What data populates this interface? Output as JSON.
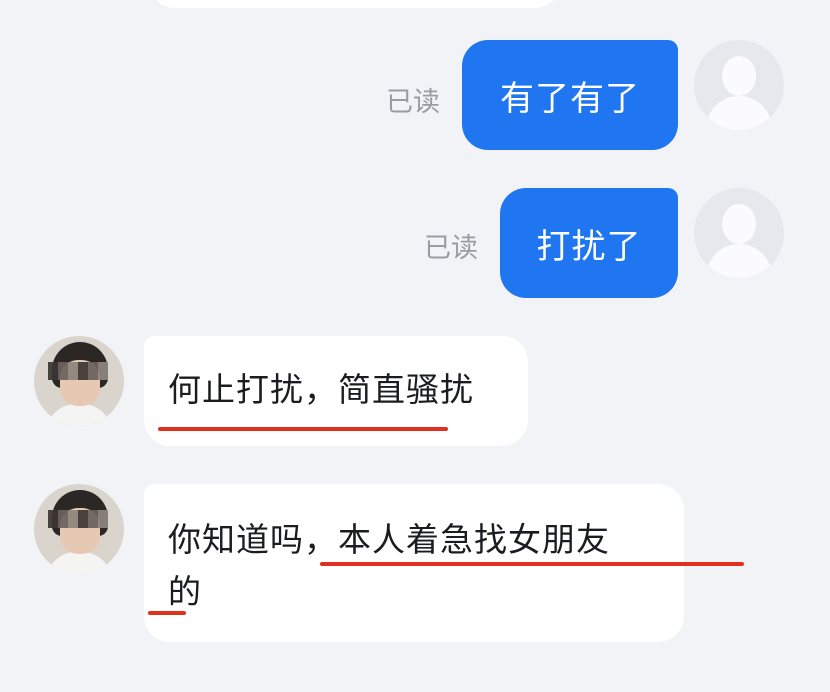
{
  "messages": [
    {
      "side": "me",
      "text": "有了有了",
      "status": "已读"
    },
    {
      "side": "me",
      "text": "打扰了",
      "status": "已读"
    },
    {
      "side": "other",
      "text": "何止打扰，简直骚扰"
    },
    {
      "side": "other",
      "line1": "你知道吗，本人着急找女朋友",
      "line2": "的"
    }
  ],
  "colors": {
    "my_bubble": "#1f76f0",
    "other_bubble": "#ffffff",
    "background": "#f2f3f7",
    "annotation_underline": "#e0301e"
  },
  "icons": {
    "self_avatar": "default-user-avatar-icon",
    "contact_avatar": "blurred-photo-avatar"
  }
}
